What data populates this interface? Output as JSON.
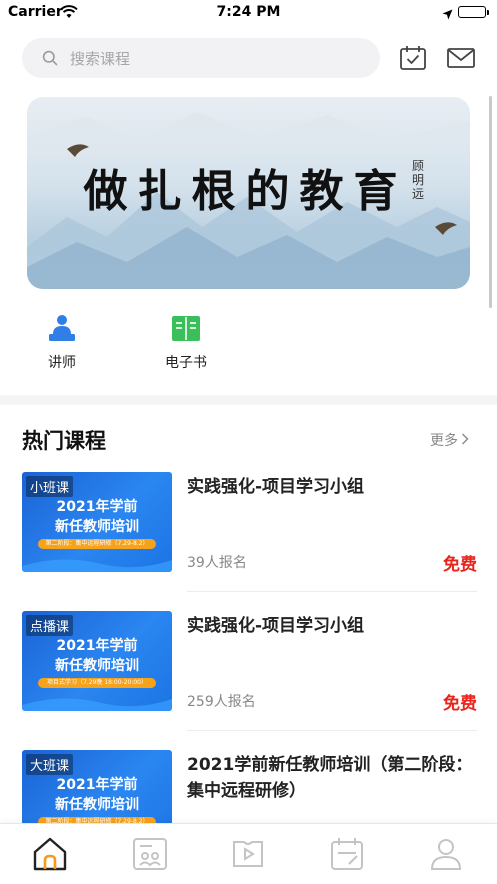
{
  "status_bar": {
    "carrier": "Carrier",
    "time": "7:24 PM"
  },
  "search": {
    "placeholder": "搜索课程",
    "icon": "search-icon"
  },
  "header_icons": [
    "calendar-check-icon",
    "mail-icon"
  ],
  "banner": {
    "title": "做扎根的教育",
    "signature": "顾明远"
  },
  "quick_entries": [
    {
      "label": "讲师",
      "icon": "lecturer-icon",
      "color": "#2f7fe6"
    },
    {
      "label": "电子书",
      "icon": "ebook-icon",
      "color": "#3bbf5b"
    }
  ],
  "hot_courses": {
    "title": "热门课程",
    "more": "更多",
    "items": [
      {
        "badge": "小班课",
        "thumb_line1": "2021年学前",
        "thumb_line2": "新任教师培训",
        "thumb_strip": "第二阶段：集中远程研修（7.29-8.2）",
        "title": "实践强化-项目学习小组",
        "count": "39人报名",
        "price": "免费"
      },
      {
        "badge": "点播课",
        "thumb_line1": "2021年学前",
        "thumb_line2": "新任教师培训",
        "thumb_strip": "项目式学习（7.29晚 18:00-20:00）",
        "title": "实践强化-项目学习小组",
        "count": "259人报名",
        "price": "免费"
      },
      {
        "badge": "大班课",
        "thumb_line1": "2021年学前",
        "thumb_line2": "新任教师培训",
        "thumb_strip": "第二阶段：集中远程研修（7.29-8.2）",
        "title": "2021学前新任教师培训（第二阶段：集中远程研修）",
        "count": "",
        "price": ""
      }
    ]
  },
  "tab_bar": [
    {
      "icon": "home-icon",
      "active": true
    },
    {
      "icon": "class-icon",
      "active": false
    },
    {
      "icon": "video-icon",
      "active": false
    },
    {
      "icon": "schedule-icon",
      "active": false
    },
    {
      "icon": "profile-icon",
      "active": false
    }
  ],
  "colors": {
    "accent": "#f39a1f",
    "price": "#e8241c",
    "search_bg": "#f2f2f4",
    "thumb_blue": "#1f6fe0"
  }
}
